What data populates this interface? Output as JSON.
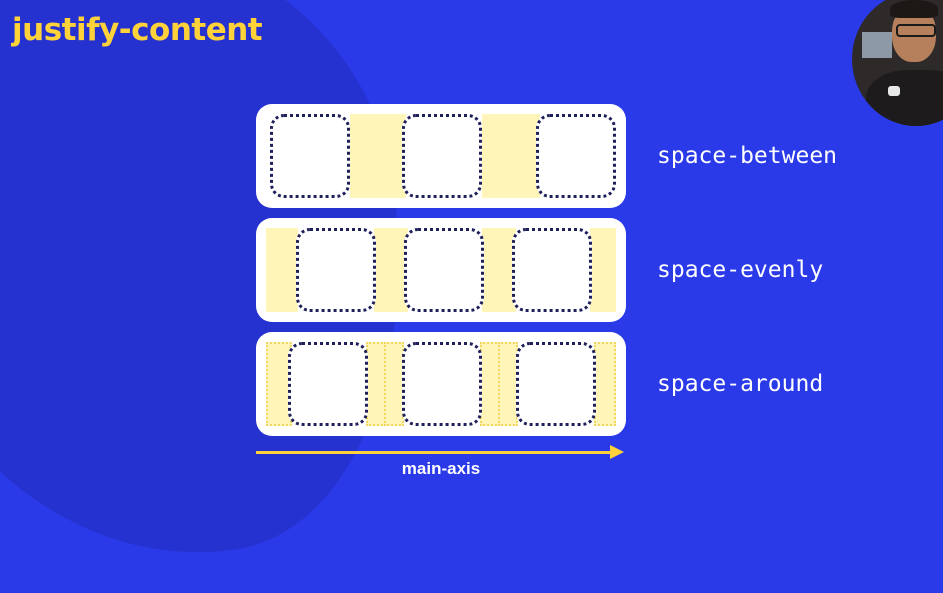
{
  "title": "justify-content",
  "rows": [
    {
      "label": "space-between"
    },
    {
      "label": "space-evenly"
    },
    {
      "label": "space-around"
    }
  ],
  "axis": {
    "label": "main-axis"
  },
  "colors": {
    "background": "#2a3ae8",
    "accent": "#ffd23a",
    "gap_fill": "#fff5b8",
    "item_border": "#1f1f5a"
  },
  "icons": [
    "arrow-right-icon"
  ]
}
